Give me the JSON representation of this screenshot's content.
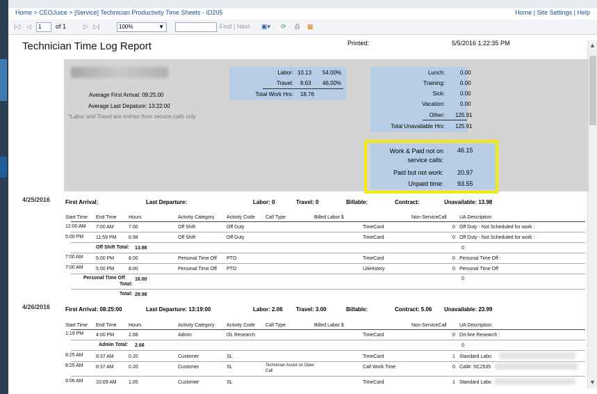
{
  "breadcrumb": "Home > CEOJuice > [Service] Technician Productivity Time Sheets - ID205",
  "top_links": "Home | Site Settings | Help",
  "toolbar": {
    "page_input": "1",
    "page_of": "of 1",
    "zoom": "100%",
    "find_next": "Find | Next"
  },
  "report": {
    "title": "Technician Time Log Report",
    "printed_label": "Printed:",
    "printed_value": "5/5/2016 1:22:35 PM"
  },
  "summary": {
    "avg_first_arrival": "Average First Arrival: 09:25:00",
    "avg_last_departure": "Average Last Depature: 13:22:00",
    "note": "*Labor and Travel are entries from service calls only",
    "labor_label": "Labor:",
    "labor_value": "10.13",
    "labor_pct": "54.00%",
    "travel_label": "Travel:",
    "travel_value": "8.63",
    "travel_pct": "46.00%",
    "total_work_label": "Total Work Hrs:",
    "total_work_value": "18.76",
    "lunch_label": "Lunch:",
    "lunch_value": "0.00",
    "training_label": "Training:",
    "training_value": "0.00",
    "sick_label": "Sick:",
    "sick_value": "0.00",
    "vacation_label": "Vacation:",
    "vacation_value": "0.00",
    "other_label": "Other:",
    "other_value": "125.91",
    "total_unavail_label": "Total Unavailable Hrs:",
    "total_unavail_value": "125.91",
    "work_paid_label1": "Work & Paid not on",
    "work_paid_label2": "service calls:",
    "work_paid_value": "46.15",
    "paid_not_work_label": "Paid but not work:",
    "paid_not_work_value": "20.97",
    "unpaid_label": "Unpaid time:",
    "unpaid_value": "93.55"
  },
  "columns": [
    "Start Time",
    "End Time",
    "Hours",
    "Activity Category",
    "Activity Code",
    "Call Type",
    "Billed Labor $",
    "Non-ServiceCall",
    "UA Description"
  ],
  "day1": {
    "date": "4/25/2016",
    "first_arrival": "First Arrival:",
    "last_departure": "Last Departure:",
    "labor": "Labor: 0",
    "travel": "Travel: 0",
    "billable": "Billable:",
    "contract": "Contract:",
    "unavailable": "Unavailable: 13.98",
    "rows": [
      {
        "start": "12:00 AM",
        "end": "7:00 AM",
        "hours": "7.00",
        "cat": "Off Shift",
        "code": "Off Duty",
        "nsc": "TimeCard",
        "num": "0",
        "ua": "Off Duty - Not Scheduled for work :"
      },
      {
        "start": "5:00 PM",
        "end": "11:59 PM",
        "hours": "6.98",
        "cat": "Off Shift",
        "code": "Off Duty",
        "nsc": "TimeCard",
        "num": "0",
        "ua": "Off Duty - Not Scheduled for work :"
      },
      {
        "start": "7:00 AM",
        "end": "5:00 PM",
        "hours": "8.00",
        "cat": "Personal Time Off",
        "code": "PTO",
        "nsc": "TimeCard",
        "num": "0",
        "ua": "Personal Time Off :"
      },
      {
        "start": "7:00 AM",
        "end": "5:00 PM",
        "hours": "8.00",
        "cat": "Personal Time Off",
        "code": "PTO",
        "nsc": "UAHistory",
        "num": "0",
        "ua": "Personal Time Off"
      }
    ],
    "offshift_total_label": "Off Shift Total:",
    "offshift_total_value": "13.98",
    "offshift_total_num": "0",
    "pto_total_label1": "Personal Time Off",
    "pto_total_label2": "Total:",
    "pto_total_value": "16.00",
    "pto_total_num": "0",
    "total_label": "Total:",
    "total_value": "29.98"
  },
  "day2": {
    "date": "4/26/2016",
    "first_arrival": "First Arrival: 08:25:00",
    "last_departure": "Last Departure: 13:19:00",
    "labor": "Labor: 2.06",
    "travel": "Travel: 3.00",
    "billable": "Billable:",
    "contract": "Contract: 5.06",
    "unavailable": "Unavailable: 23.99",
    "rows": [
      {
        "start": "1:19 PM",
        "end": "4:00 PM",
        "hours": "2.68",
        "cat": "Admin",
        "code": "OL Research",
        "calltype": "",
        "nsc": "TimeCard",
        "num": "0",
        "ua": "On-line Research :"
      },
      {
        "start": "8:25 AM",
        "end": "8:37 AM",
        "hours": "0.20",
        "cat": "Customer",
        "code": "SL",
        "calltype": "",
        "nsc": "TimeCard",
        "num": "1",
        "ua": "Standard Labo"
      },
      {
        "start": "8:25 AM",
        "end": "8:37 AM",
        "hours": "0.20",
        "cat": "Customer",
        "code": "SL",
        "calltype": "Technician Assist on Open Call",
        "nsc": "Call Work Time",
        "num": "0",
        "ua": "Call#: SC2535"
      },
      {
        "start": "9:06 AM",
        "end": "10:09 AM",
        "hours": "1.05",
        "cat": "Customer",
        "code": "SL",
        "calltype": "",
        "nsc": "TimeCard",
        "num": "1",
        "ua": "Standard Labo"
      }
    ],
    "admin_total_label": "Admin Total:",
    "admin_total_value": "2.68",
    "admin_total_num": "0"
  }
}
